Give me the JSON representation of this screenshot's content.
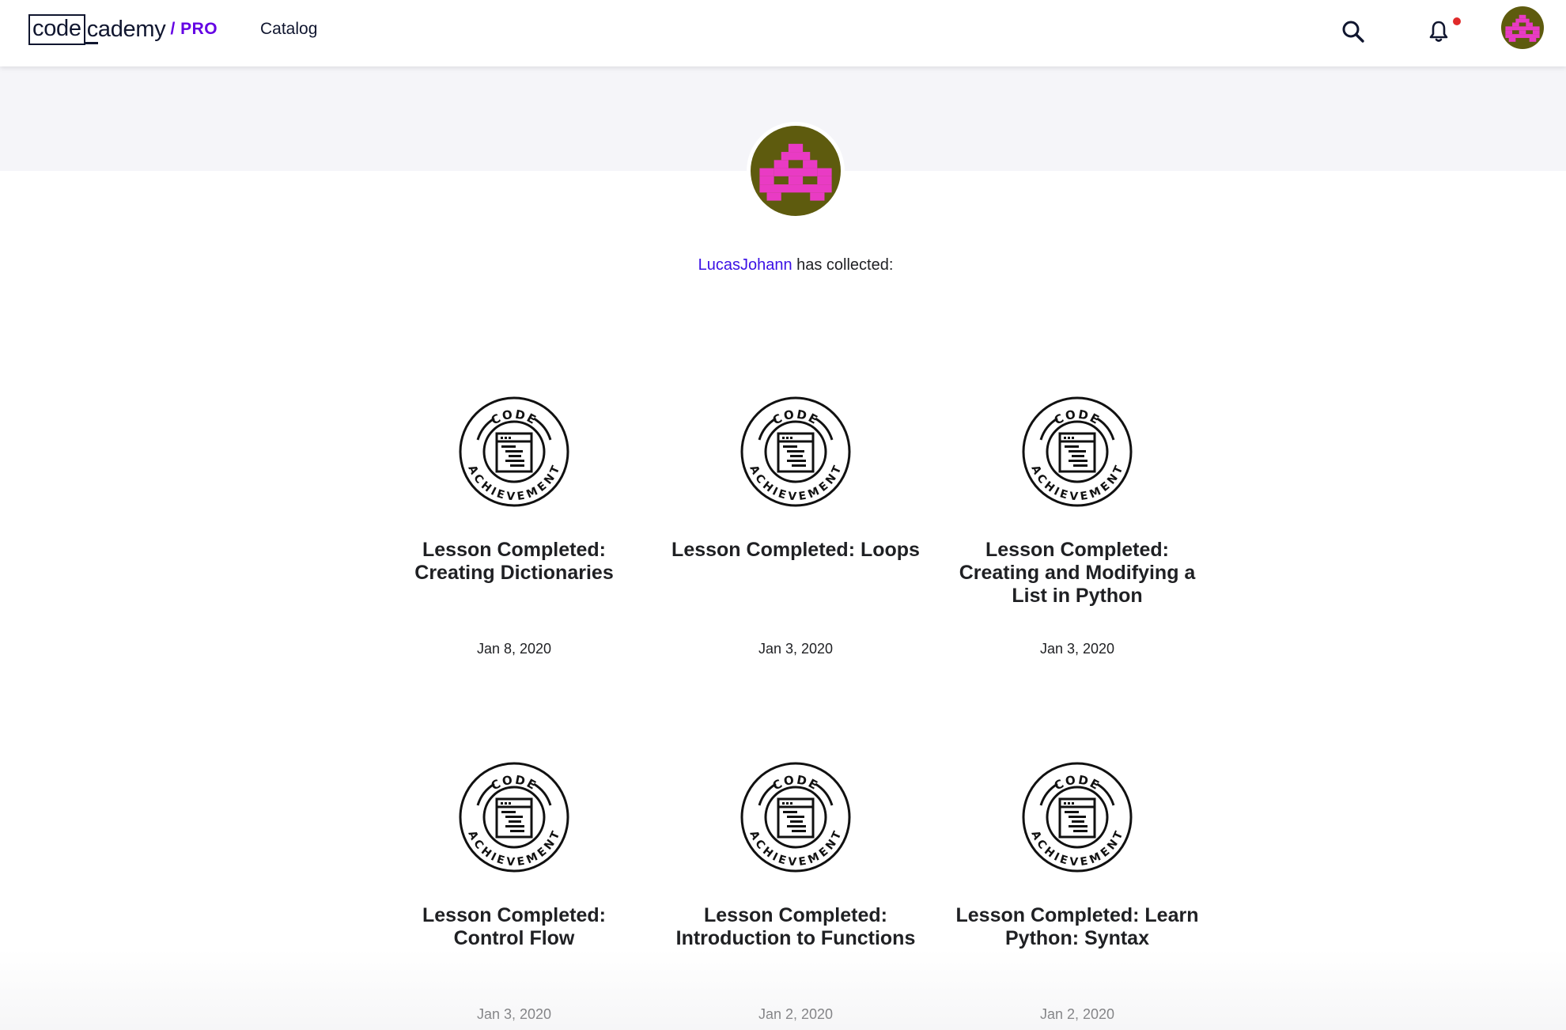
{
  "header": {
    "logo_code": "code",
    "logo_cademy": "cademy",
    "logo_pro": "/ PRO",
    "catalog_label": "Catalog",
    "has_notification": true
  },
  "profile": {
    "username": "LucasJohann",
    "collected_suffix": " has collected:"
  },
  "badge_text": {
    "top": "CODE",
    "bottom": "ACHIEVEMENT"
  },
  "achievements": [
    {
      "title": "Lesson Completed: Creating Dictionaries",
      "date": "Jan 8, 2020"
    },
    {
      "title": "Lesson Completed: Loops",
      "date": "Jan 3, 2020"
    },
    {
      "title": "Lesson Completed: Creating and Modifying a List in Python",
      "date": "Jan 3, 2020"
    },
    {
      "title": "Lesson Completed: Control Flow",
      "date": "Jan 3, 2020"
    },
    {
      "title": "Lesson Completed: Introduction to Functions",
      "date": "Jan 2, 2020"
    },
    {
      "title": "Lesson Completed: Learn Python: Syntax",
      "date": "Jan 2, 2020"
    }
  ],
  "colors": {
    "brand_dark": "#10162f",
    "pro_purple": "#6400e4",
    "link_blue": "#3a10e5",
    "avatar_bg": "#5e5b0e",
    "avatar_pixel": "#e93bc4",
    "notification_dot": "#e02a2a",
    "banner_bg": "#f5f5f9"
  }
}
